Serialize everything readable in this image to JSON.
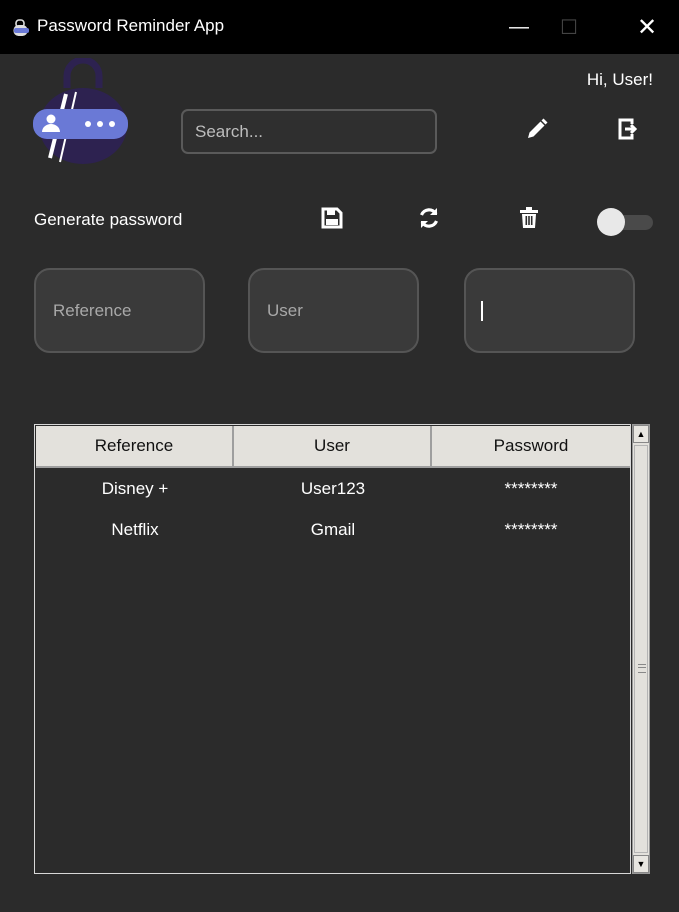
{
  "window": {
    "title": "Password Reminder App",
    "minimize": "—",
    "maximize": "☐",
    "close": "✕"
  },
  "header": {
    "greeting": "Hi, User!",
    "search_placeholder": "Search...",
    "edit_icon": "pencil-icon",
    "logout_icon": "logout-icon"
  },
  "toolbar": {
    "generate_label": "Generate password",
    "save_icon": "floppy-disk-icon",
    "refresh_icon": "refresh-icon",
    "delete_icon": "trash-icon",
    "toggle_state": "off"
  },
  "form": {
    "reference_placeholder": "Reference",
    "user_placeholder": "User",
    "password_value": ""
  },
  "table": {
    "columns": [
      "Reference",
      "User",
      "Password"
    ],
    "rows": [
      [
        "Disney +",
        "User123",
        "********"
      ],
      [
        "Netflix",
        "Gmail",
        "********"
      ]
    ]
  },
  "colors": {
    "background": "#2b2b2b",
    "titlebar": "#000000",
    "logo_purple": "#2d2250",
    "logo_badge": "#6a79d6",
    "header_cells": "#e3e1dc"
  }
}
